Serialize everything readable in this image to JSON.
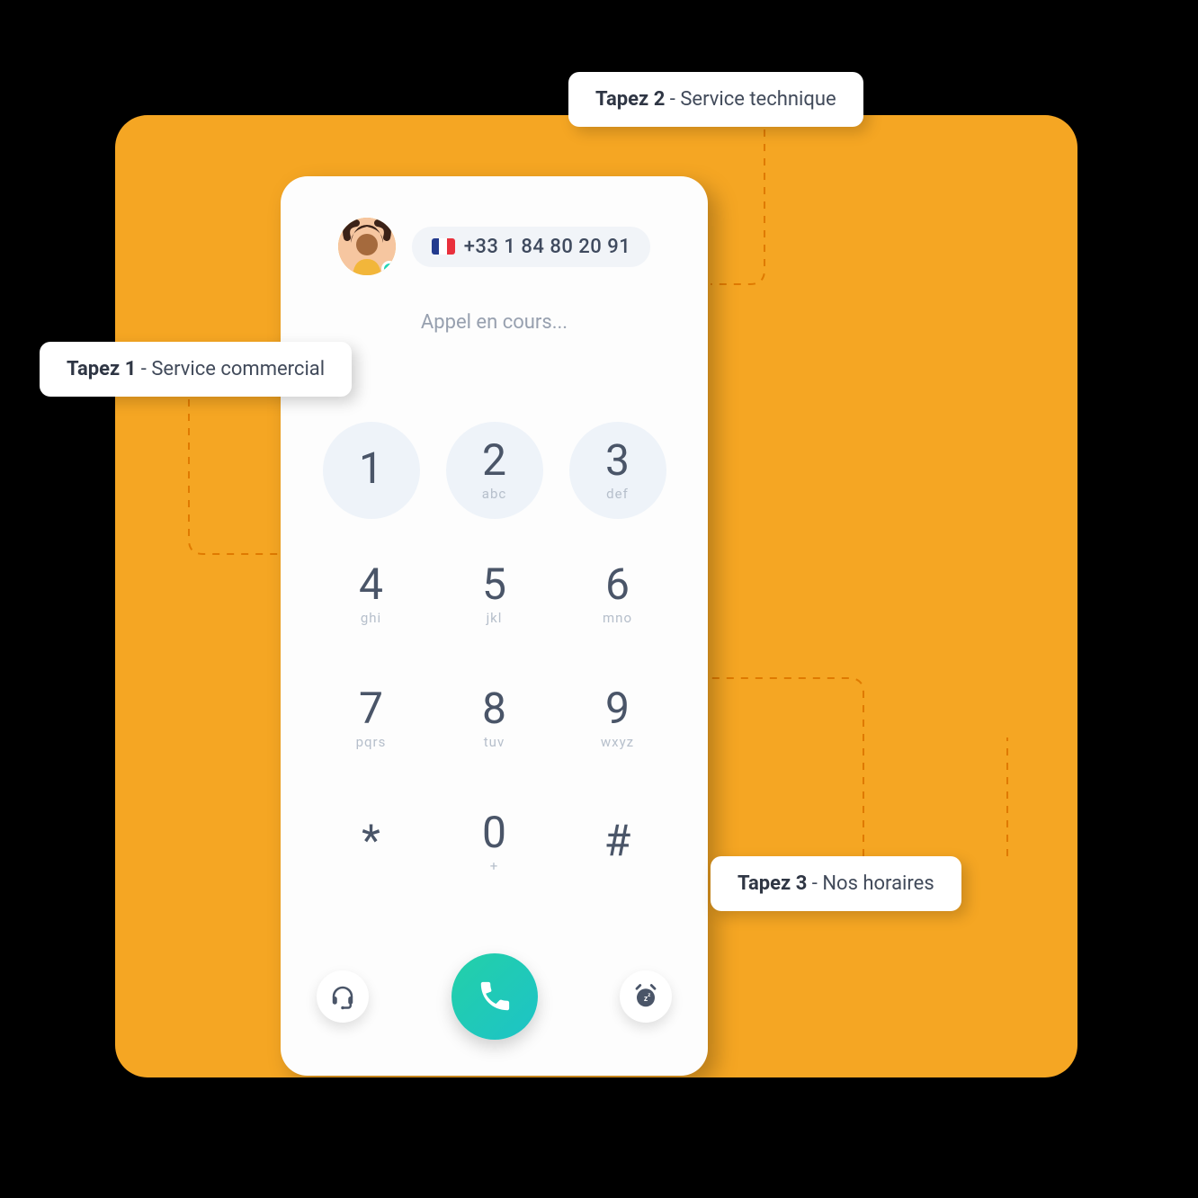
{
  "phone": {
    "number": "+33 1 84 80 20 91",
    "status": "Appel en cours...",
    "country": "FR"
  },
  "keypad": [
    {
      "digit": "1",
      "letters": "",
      "highlight": true
    },
    {
      "digit": "2",
      "letters": "abc",
      "highlight": true
    },
    {
      "digit": "3",
      "letters": "def",
      "highlight": true
    },
    {
      "digit": "4",
      "letters": "ghi",
      "highlight": false
    },
    {
      "digit": "5",
      "letters": "jkl",
      "highlight": false
    },
    {
      "digit": "6",
      "letters": "mno",
      "highlight": false
    },
    {
      "digit": "7",
      "letters": "pqrs",
      "highlight": false
    },
    {
      "digit": "8",
      "letters": "tuv",
      "highlight": false
    },
    {
      "digit": "9",
      "letters": "wxyz",
      "highlight": false
    },
    {
      "digit": "*",
      "letters": "",
      "highlight": false
    },
    {
      "digit": "0",
      "letters": "+",
      "highlight": false
    },
    {
      "digit": "#",
      "letters": "",
      "highlight": false
    }
  ],
  "callouts": {
    "one": {
      "bold": "Tapez 1",
      "rest": " - Service commercial"
    },
    "two": {
      "bold": "Tapez 2",
      "rest": " - Service technique"
    },
    "three": {
      "bold": "Tapez 3",
      "rest": " - Nos horaires"
    }
  },
  "icons": {
    "headset": "headset-icon",
    "call": "phone-handset-icon",
    "snooze": "alarm-snooze-icon"
  },
  "colors": {
    "accent_orange": "#f5a623",
    "call_green": "#1fcdb7",
    "digit": "#4a5568"
  }
}
